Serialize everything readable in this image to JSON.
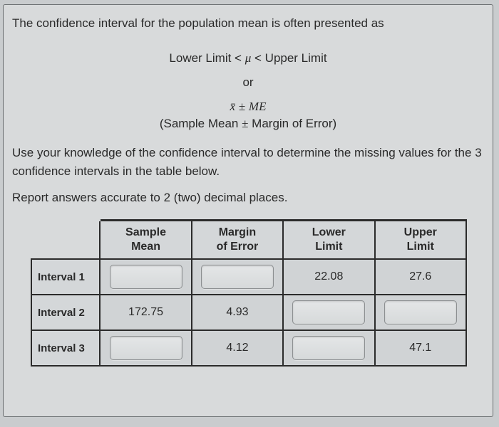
{
  "intro": "The confidence interval for the population mean is often presented as",
  "formula_lower_upper_prefix": "Lower Limit ",
  "formula_lt1": "<",
  "formula_mu": "μ",
  "formula_lt2": "<",
  "formula_lower_upper_suffix": " Upper Limit",
  "or_text": "or",
  "formula_xbar": "x̄",
  "formula_pm": "±",
  "formula_ME": "ME",
  "formula_words_pre": "(Sample Mean ",
  "formula_words_pm": "±",
  "formula_words_post": " Margin of Error)",
  "instruction1": "Use your knowledge of the confidence interval to determine the missing values for the 3 confidence intervals in the table below.",
  "instruction2": "Report answers accurate to 2 (two) decimal places.",
  "headers": {
    "sample_mean_l1": "Sample",
    "sample_mean_l2": "Mean",
    "margin_l1": "Margin",
    "margin_l2": "of Error",
    "lower_l1": "Lower",
    "lower_l2": "Limit",
    "upper_l1": "Upper",
    "upper_l2": "Limit"
  },
  "rows": [
    {
      "label": "Interval 1",
      "sample_mean": "",
      "margin": "",
      "lower": "22.08",
      "upper": "27.6",
      "editable": {
        "sample_mean": true,
        "margin": true,
        "lower": false,
        "upper": false
      }
    },
    {
      "label": "Interval 2",
      "sample_mean": "172.75",
      "margin": "4.93",
      "lower": "",
      "upper": "",
      "editable": {
        "sample_mean": false,
        "margin": false,
        "lower": true,
        "upper": true
      }
    },
    {
      "label": "Interval 3",
      "sample_mean": "",
      "margin": "4.12",
      "lower": "",
      "upper": "47.1",
      "editable": {
        "sample_mean": true,
        "margin": false,
        "lower": true,
        "upper": false
      }
    }
  ]
}
